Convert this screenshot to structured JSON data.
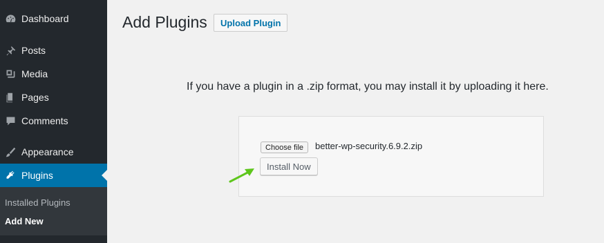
{
  "sidebar": {
    "items": [
      {
        "label": "Dashboard",
        "icon": "dashboard-icon"
      },
      {
        "label": "Posts",
        "icon": "pushpin-icon"
      },
      {
        "label": "Media",
        "icon": "media-icon"
      },
      {
        "label": "Pages",
        "icon": "pages-icon"
      },
      {
        "label": "Comments",
        "icon": "comment-bubble-icon"
      },
      {
        "label": "Appearance",
        "icon": "paintbrush-icon"
      },
      {
        "label": "Plugins",
        "icon": "plugin-icon",
        "active": true
      }
    ],
    "submenu": [
      {
        "label": "Installed Plugins"
      },
      {
        "label": "Add New",
        "current": true
      }
    ]
  },
  "main": {
    "title": "Add Plugins",
    "upload_button": "Upload Plugin",
    "intro_text": "If you have a plugin in a .zip format, you may install it by uploading it here.",
    "choose_file_label": "Choose file",
    "file_name": "better-wp-security.6.9.2.zip",
    "install_button": "Install Now"
  },
  "colors": {
    "sidebar_bg": "#23282d",
    "active_bg": "#0073aa",
    "link": "#0073aa",
    "arrow": "#5ec61c"
  }
}
